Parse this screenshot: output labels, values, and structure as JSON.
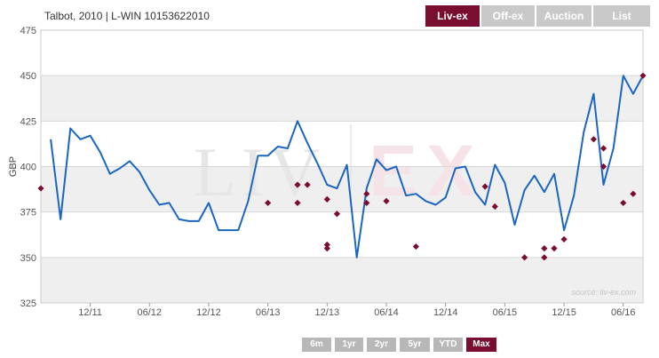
{
  "title": "Talbot, 2010 | L-WIN 10153622010",
  "tabs": [
    {
      "label": "Liv-ex",
      "active": true
    },
    {
      "label": "Off-ex",
      "active": false
    },
    {
      "label": "Auction",
      "active": false
    },
    {
      "label": "List",
      "active": false
    }
  ],
  "range_buttons": [
    {
      "label": "6m",
      "active": false
    },
    {
      "label": "1yr",
      "active": false
    },
    {
      "label": "2yr",
      "active": false
    },
    {
      "label": "5yr",
      "active": false
    },
    {
      "label": "YTD",
      "active": false
    },
    {
      "label": "Max",
      "active": true
    }
  ],
  "colors": {
    "line": "#1a66c0",
    "points": "#7a0e30",
    "accent": "#7a0e30",
    "band": "#efefef",
    "watermark": "#e6e6e6"
  },
  "watermark": {
    "left": "LIV",
    "right": "EX"
  },
  "chart_data": {
    "type": "line",
    "ylabel": "GBP",
    "ylim": [
      325,
      475
    ],
    "yticks": [
      325,
      350,
      375,
      400,
      425,
      450,
      475
    ],
    "xticks": [
      "12/11",
      "06/12",
      "12/12",
      "06/13",
      "12/13",
      "06/14",
      "12/14",
      "06/15",
      "12/15",
      "06/16"
    ],
    "source_label": "source: liv-ex.com",
    "grid": true,
    "series": [
      {
        "kind": "line",
        "x": [
          "2011-08",
          "2011-09",
          "2011-10",
          "2011-11",
          "2011-12",
          "2012-01",
          "2012-02",
          "2012-03",
          "2012-04",
          "2012-05",
          "2012-06",
          "2012-07",
          "2012-08",
          "2012-09",
          "2012-10",
          "2012-11",
          "2012-12",
          "2013-01",
          "2013-02",
          "2013-03",
          "2013-04",
          "2013-05",
          "2013-06",
          "2013-07",
          "2013-08",
          "2013-09",
          "2013-10",
          "2013-11",
          "2013-12",
          "2014-01",
          "2014-02",
          "2014-03",
          "2014-04",
          "2014-05",
          "2014-06",
          "2014-07",
          "2014-08",
          "2014-09",
          "2014-10",
          "2014-11",
          "2014-12",
          "2015-01",
          "2015-02",
          "2015-03",
          "2015-04",
          "2015-05",
          "2015-06",
          "2015-07",
          "2015-08",
          "2015-09",
          "2015-10",
          "2015-11",
          "2015-12",
          "2016-01",
          "2016-02",
          "2016-03",
          "2016-04",
          "2016-05",
          "2016-06",
          "2016-07",
          "2016-08"
        ],
        "y": [
          415,
          371,
          421,
          415,
          417,
          408,
          396,
          399,
          403,
          397,
          387,
          379,
          380,
          371,
          370,
          370,
          380,
          365,
          365,
          365,
          381,
          406,
          406,
          411,
          410,
          425,
          413,
          402,
          390,
          388,
          401,
          350,
          388,
          404,
          398,
          400,
          384,
          385,
          381,
          379,
          383,
          399,
          400,
          386,
          379,
          401,
          391,
          368,
          387,
          395,
          386,
          396,
          365,
          384,
          419,
          440,
          390,
          410,
          450,
          440,
          450
        ]
      },
      {
        "kind": "scatter",
        "points": [
          [
            "2011-07",
            388
          ],
          [
            "2013-06",
            380
          ],
          [
            "2013-09",
            380
          ],
          [
            "2013-09",
            390
          ],
          [
            "2013-10",
            390
          ],
          [
            "2013-12",
            382
          ],
          [
            "2013-12",
            357
          ],
          [
            "2013-12",
            355
          ],
          [
            "2014-01",
            374
          ],
          [
            "2014-04",
            380
          ],
          [
            "2014-04",
            385
          ],
          [
            "2014-06",
            381
          ],
          [
            "2014-09",
            356
          ],
          [
            "2015-04",
            389
          ],
          [
            "2015-05",
            378
          ],
          [
            "2015-08",
            350
          ],
          [
            "2015-10",
            355
          ],
          [
            "2015-10",
            350
          ],
          [
            "2015-11",
            355
          ],
          [
            "2015-12",
            360
          ],
          [
            "2016-03",
            415
          ],
          [
            "2016-04",
            400
          ],
          [
            "2016-04",
            410
          ],
          [
            "2016-06",
            380
          ],
          [
            "2016-07",
            385
          ],
          [
            "2016-08",
            450
          ]
        ]
      }
    ]
  }
}
